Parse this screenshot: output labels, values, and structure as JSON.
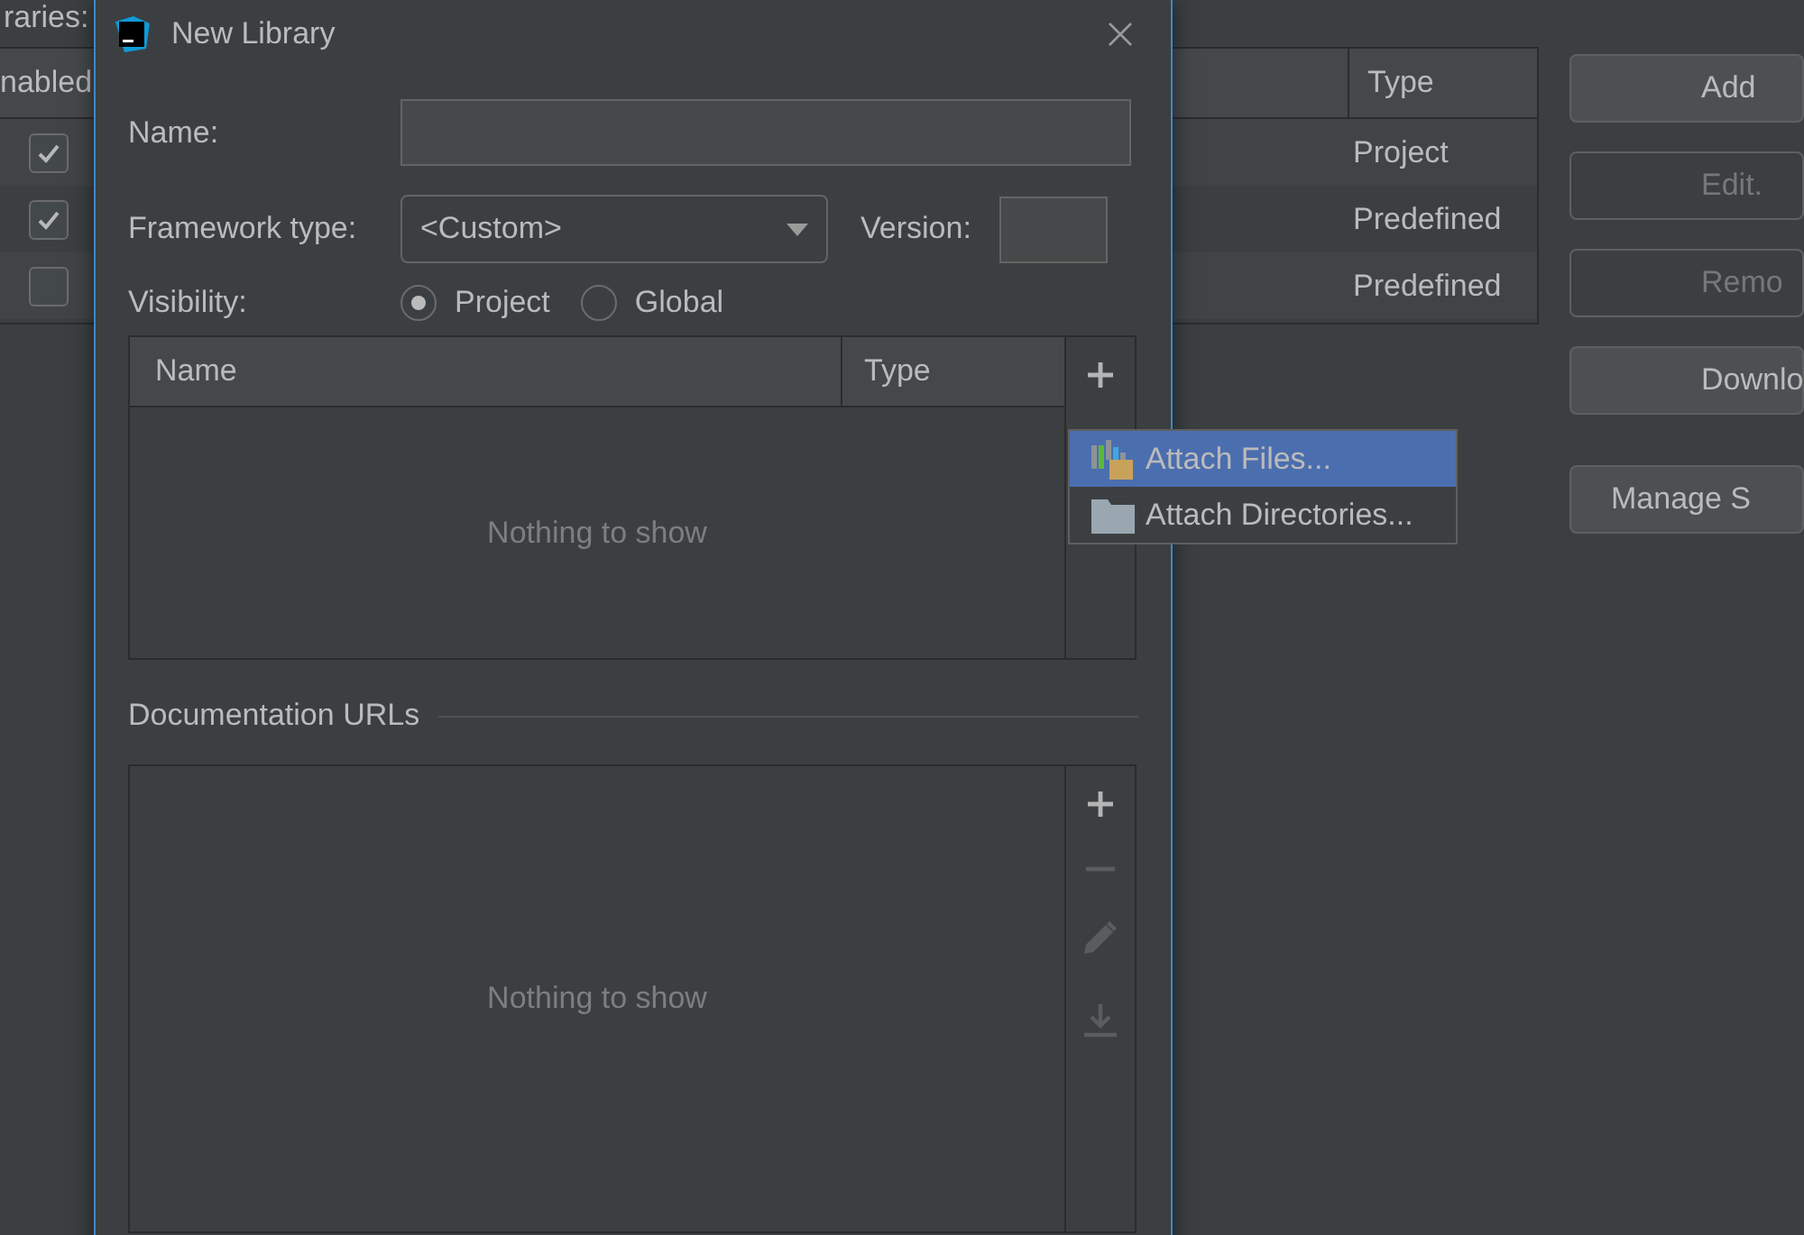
{
  "background": {
    "section_label": "raries:",
    "columns": [
      "nabled",
      "Type"
    ],
    "rows": [
      {
        "checked": true,
        "type": "Project"
      },
      {
        "checked": true,
        "type": "Predefined"
      },
      {
        "checked": false,
        "type": "Predefined"
      }
    ],
    "buttons": [
      {
        "label": "Add",
        "disabled": false
      },
      {
        "label": "Edit.",
        "disabled": true
      },
      {
        "label": "Remo",
        "disabled": true
      },
      {
        "label": "Downlo",
        "disabled": false
      },
      {
        "label": "Manage S",
        "disabled": false
      }
    ]
  },
  "dialog": {
    "title": "New Library",
    "name_label": "Name:",
    "framework_label": "Framework type:",
    "framework_value": "<Custom>",
    "version_label": "Version:",
    "visibility_label": "Visibility:",
    "visibility_options": [
      {
        "label": "Project",
        "selected": true
      },
      {
        "label": "Global",
        "selected": false
      }
    ],
    "roots_table": {
      "columns": [
        "Name",
        "Type"
      ],
      "empty_text": "Nothing to show"
    },
    "docs_label": "Documentation URLs",
    "docs_table": {
      "empty_text": "Nothing to show",
      "tools": [
        {
          "kind": "add",
          "disabled": false
        },
        {
          "kind": "remove",
          "disabled": true
        },
        {
          "kind": "edit",
          "disabled": true
        },
        {
          "kind": "download",
          "disabled": true
        }
      ]
    }
  },
  "menu": [
    {
      "kind": "files",
      "label": "Attach Files...",
      "selected": true
    },
    {
      "kind": "folder",
      "label": "Attach Directories...",
      "selected": false
    }
  ]
}
